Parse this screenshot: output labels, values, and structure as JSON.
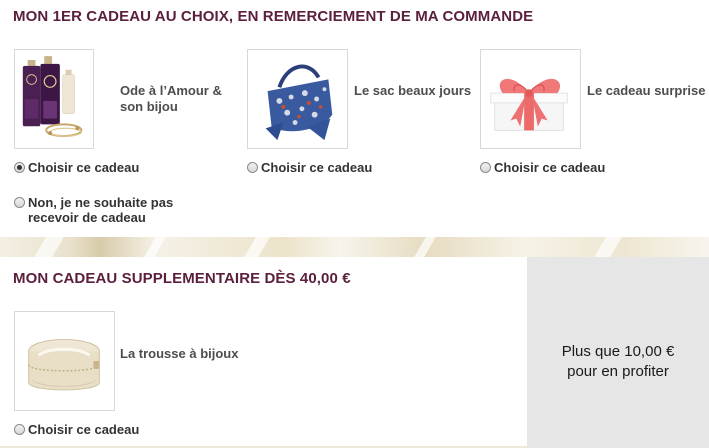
{
  "section1": {
    "title": "MON 1ER CADEAU AU CHOIX, EN REMERCIEMENT DE MA COMMANDE",
    "gifts": [
      {
        "label_line1": "Ode à l’Amour &",
        "label_line2": "son bijou",
        "radio_label": "Choisir ce cadeau",
        "selected": true,
        "icon": "perfume-bottles-bracelet-image"
      },
      {
        "label_line1": "Le sac beaux jours",
        "label_line2": "",
        "radio_label": "Choisir ce cadeau",
        "selected": false,
        "icon": "floral-bag-image"
      },
      {
        "label_line1": "Le cadeau surprise",
        "label_line2": "",
        "radio_label": "Choisir ce cadeau",
        "selected": false,
        "icon": "gift-box-image"
      }
    ],
    "no_gift": {
      "line1": "Non, je ne souhaite pas",
      "line2": "recevoir de cadeau",
      "selected": false
    }
  },
  "section2": {
    "title": "MON CADEAU SUPPLEMENTAIRE DÈS 40,00 €",
    "gift": {
      "label": "La trousse à bijoux",
      "radio_label": "Choisir ce cadeau",
      "selected": false,
      "icon": "jewelry-case-image"
    },
    "cta_line1": "Plus que 10,00 €",
    "cta_line2": "pour en profiter"
  },
  "colors": {
    "title": "#5b1e3c",
    "panel": "#e6e6e6",
    "accent_purple": "#4a1f52"
  }
}
